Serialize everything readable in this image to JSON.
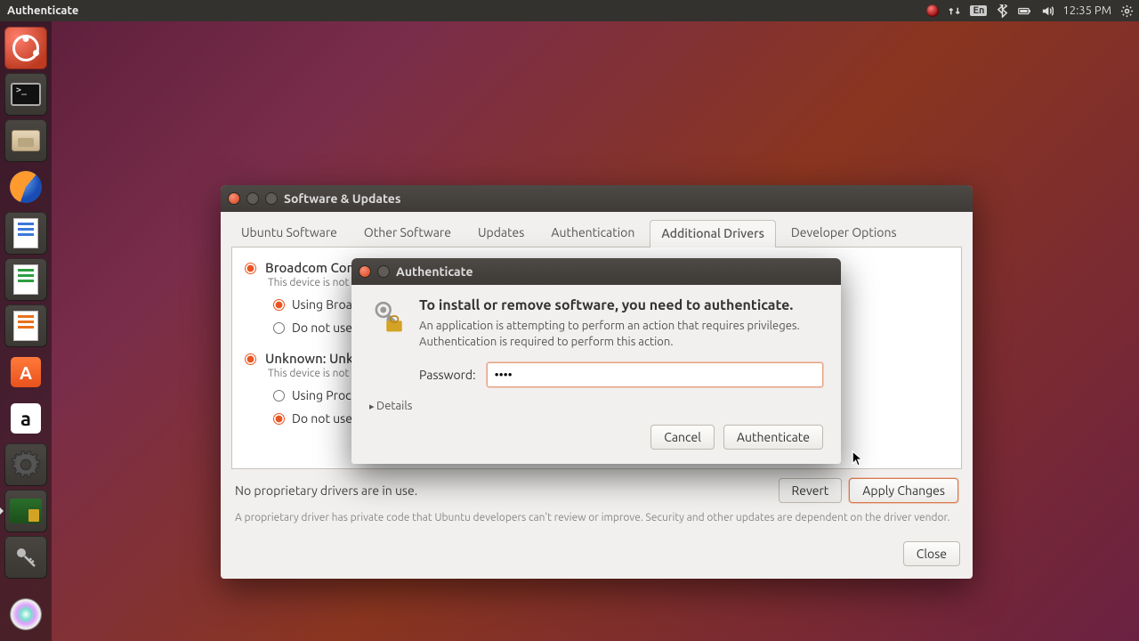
{
  "panel": {
    "title": "Authenticate",
    "lang": "En",
    "clock": "12:35 PM"
  },
  "window": {
    "title": "Software & Updates",
    "tabs": [
      "Ubuntu Software",
      "Other Software",
      "Updates",
      "Authentication",
      "Additional Drivers",
      "Developer Options"
    ],
    "active_tab": 4,
    "devices": [
      {
        "title": "Broadcom Cor",
        "subtitle": "This device is not",
        "options": [
          {
            "label": "Using Broa",
            "checked": true
          },
          {
            "label": "Do not use",
            "checked": false
          }
        ]
      },
      {
        "title": "Unknown: Unk",
        "subtitle": "This device is not",
        "options": [
          {
            "label": "Using Proc",
            "checked": false
          },
          {
            "label": "Do not use",
            "checked": true
          }
        ]
      }
    ],
    "status": "No proprietary drivers are in use.",
    "revert": "Revert",
    "apply": "Apply Changes",
    "note": "A proprietary driver has private code that Ubuntu developers can't review or improve. Security and other updates are dependent on the driver vendor.",
    "close": "Close"
  },
  "dialog": {
    "title": "Authenticate",
    "heading": "To install or remove software, you need to authenticate.",
    "message": "An application is attempting to perform an action that requires privileges. Authentication is required to perform this action.",
    "password_label": "Password:",
    "password_value": "••••",
    "details": "Details",
    "cancel": "Cancel",
    "authenticate": "Authenticate"
  }
}
